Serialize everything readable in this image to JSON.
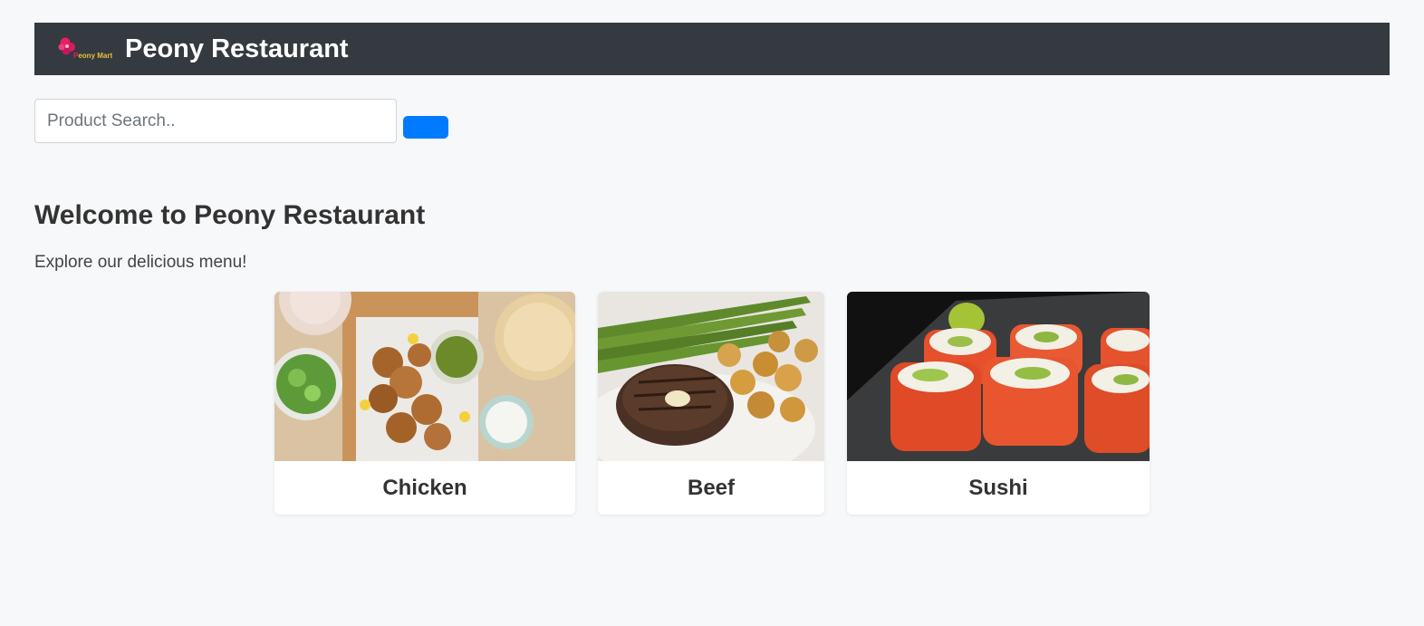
{
  "header": {
    "logo_text_a": "P",
    "logo_text_b": "eony Mart",
    "title": "Peony Restaurant"
  },
  "search": {
    "placeholder": "Product Search..",
    "value": "",
    "button_label": ""
  },
  "main": {
    "welcome": "Welcome to Peony Restaurant",
    "subtitle": "Explore our delicious menu!"
  },
  "menu": {
    "items": [
      {
        "label": "Chicken"
      },
      {
        "label": "Beef"
      },
      {
        "label": "Sushi"
      }
    ]
  },
  "colors": {
    "header_bg": "#343a40",
    "accent": "#007bff",
    "brand_pink": "#e91e63",
    "brand_gold": "#e8c13a"
  }
}
